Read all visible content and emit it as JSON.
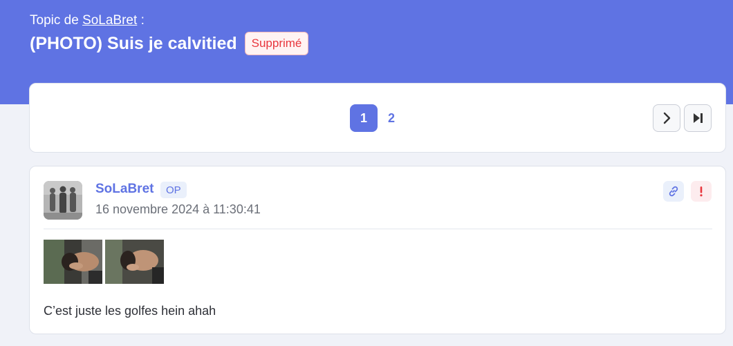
{
  "header": {
    "topic_prefix": "Topic de",
    "author": "SoLaBret",
    "topic_suffix": " :",
    "title": "(PHOTO) Suis je calvitied",
    "status_badge": "Supprimé"
  },
  "pagination": {
    "pages": [
      "1",
      "2"
    ],
    "current_page": "1",
    "next_icon": "chevron-right-icon",
    "last_icon": "skip-to-last-icon"
  },
  "post": {
    "author": "SoLaBret",
    "op_badge": "OP",
    "date": "16 novembre 2024 à 11:30:41",
    "actions": [
      "link-icon",
      "report-icon"
    ],
    "text": "C’est juste les golfes hein ahah",
    "images_count": 2
  },
  "colors": {
    "accent": "#5f73e3",
    "danger": "#e8363d",
    "background": "#f0f2f8"
  }
}
